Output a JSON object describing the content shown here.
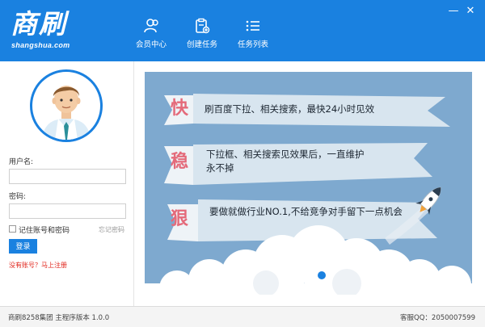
{
  "app": {
    "logo_text": "商刷",
    "logo_url": "shangshua.com"
  },
  "colors": {
    "primary": "#1a81e0",
    "banner_bg": "#7ea9cf",
    "key_word": "#e46a7a",
    "register_link": "#e0241b"
  },
  "nav": [
    {
      "label": "会员中心",
      "icon": "user-icon"
    },
    {
      "label": "创建任务",
      "icon": "create-task-icon"
    },
    {
      "label": "任务列表",
      "icon": "task-list-icon"
    }
  ],
  "window_controls": {
    "minimize": "—",
    "close": "✕"
  },
  "login": {
    "username_label": "用户名:",
    "username_value": "",
    "password_label": "密码:",
    "password_value": "",
    "remember_label": "记住账号和密码",
    "remember_checked": false,
    "forgot_label": "忘记密码",
    "login_button": "登录",
    "register_link": "没有账号？马上注册"
  },
  "banner": {
    "items": [
      {
        "key": "快",
        "text": "刷百度下拉、相关搜索，最快24小时见效"
      },
      {
        "key": "稳",
        "text": "下拉框、相关搜索见效果后，一直维护永不掉"
      },
      {
        "key": "狠",
        "text": "要做就做行业NO.1,不给竞争对手留下一点机会"
      }
    ]
  },
  "status": {
    "left": "商刷8258集团  主程序版本 1.0.0",
    "right": "客服QQ：2050007599"
  }
}
